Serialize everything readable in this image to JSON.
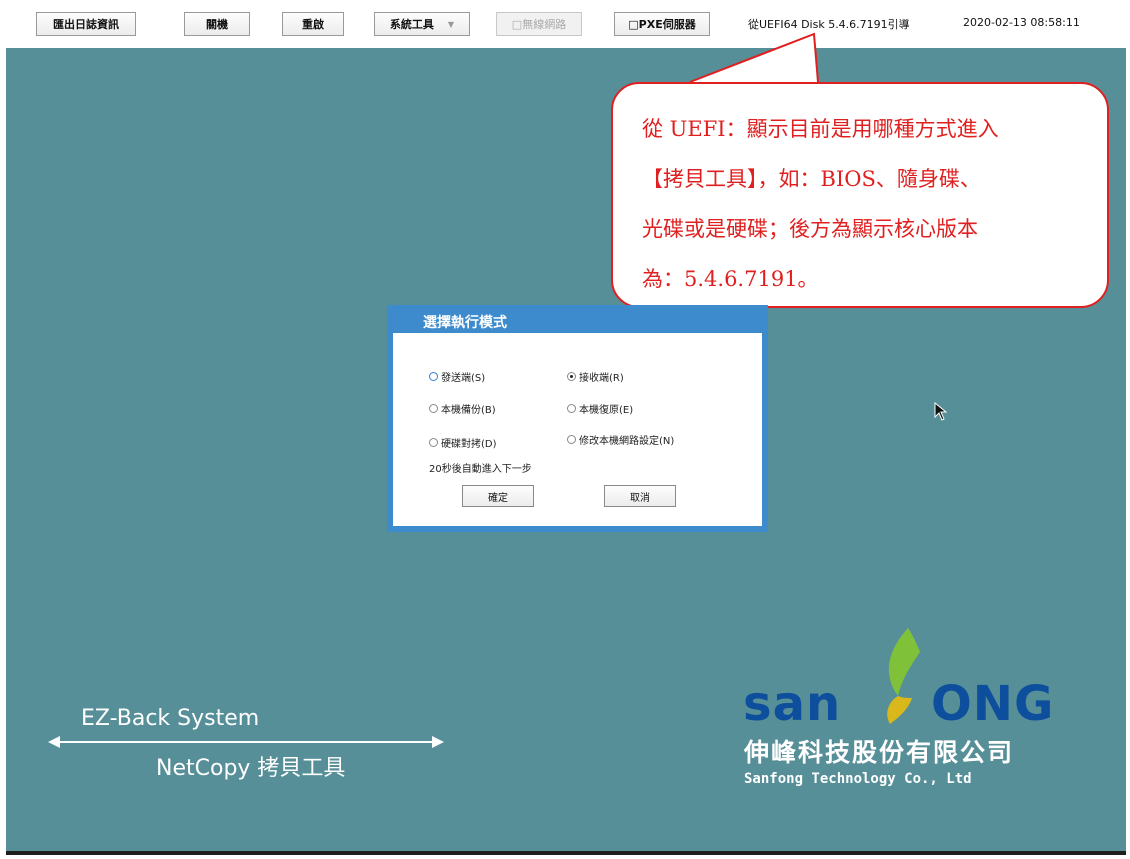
{
  "toolbar": {
    "export_log": "匯出日誌資訊",
    "shutdown": "關機",
    "reboot": "重啟",
    "system_tools": "系統工具",
    "wireless": "□無線網路",
    "pxe_server": "□PXE伺服器",
    "boot_info": "從UEFI64 Disk 5.4.6.7191引導",
    "datetime": "2020-02-13 08:58:11"
  },
  "callout": {
    "lines": [
      "從 UEFI：顯示目前是用哪種方式進入",
      "【拷貝工具】，如：BIOS、隨身碟、",
      "光碟或是硬碟；後方為顯示核心版本",
      "為：5.4.6.7191。"
    ]
  },
  "dialog": {
    "title": "選擇執行模式",
    "options": {
      "sender": "發送端(S)",
      "receiver": "接收端(R)",
      "backup": "本機備份(B)",
      "restore": "本機復原(E)",
      "disk_copy": "硬碟對拷(D)",
      "network": "修改本機網路設定(N)"
    },
    "selected": "receiver",
    "countdown": "20秒後自動進入下一步",
    "ok": "確定",
    "cancel": "取消"
  },
  "branding": {
    "product_title": "EZ-Back System",
    "product_subtitle": "NetCopy 拷貝工具",
    "logo_left": "san",
    "logo_right": "ONG",
    "company_zh": "伸峰科技股份有限公司",
    "company_en": "Sanfong Technology Co., Ltd"
  },
  "colors": {
    "desktop": "#568f98",
    "dialog_header": "#3d8bcc",
    "callout_red": "#e02020",
    "logo_blue": "#0d4f9c",
    "leaf_green": "#7fc23a"
  }
}
